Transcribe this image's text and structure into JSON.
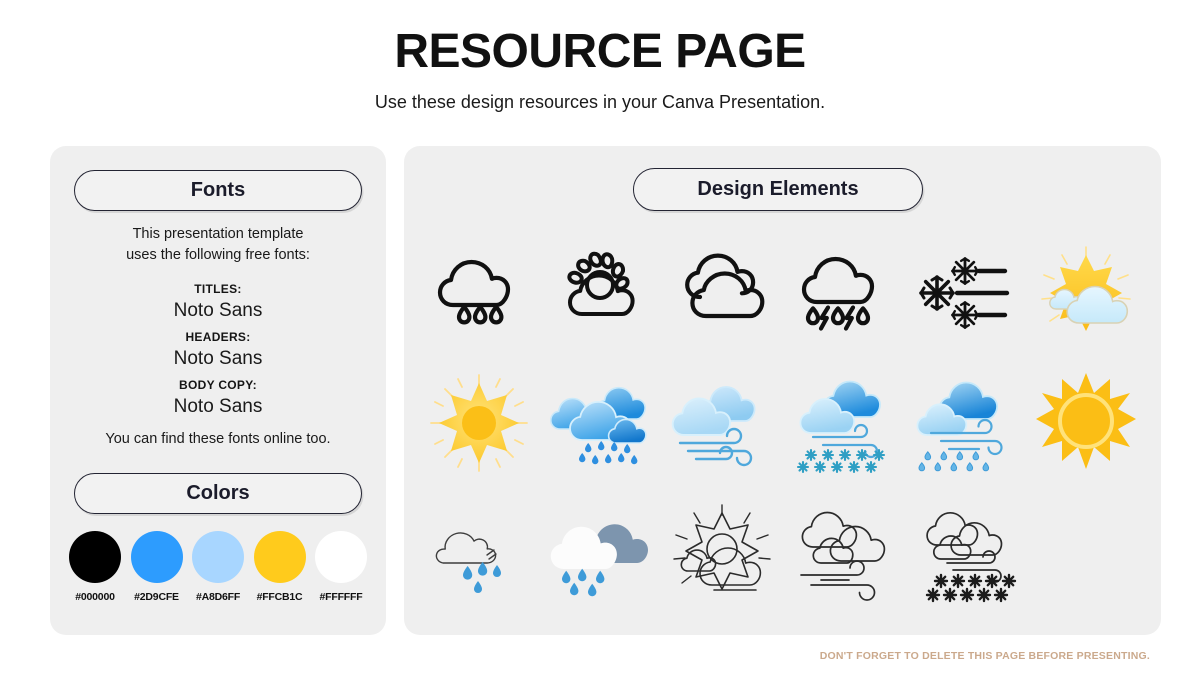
{
  "header": {
    "title": "RESOURCE PAGE",
    "subtitle": "Use these design resources in your Canva Presentation."
  },
  "fonts_panel": {
    "pill_label": "Fonts",
    "intro": "This presentation template\nuses the following free fonts:",
    "groups": [
      {
        "label": "TITLES:",
        "value": "Noto Sans"
      },
      {
        "label": "HEADERS:",
        "value": "Noto Sans"
      },
      {
        "label": "BODY COPY:",
        "value": "Noto Sans"
      }
    ],
    "outro": "You can find these fonts online too."
  },
  "colors_panel": {
    "pill_label": "Colors",
    "swatches": [
      {
        "code": "#000000",
        "hex": "#000000"
      },
      {
        "code": "#2D9CFE",
        "hex": "#2D9CFE"
      },
      {
        "code": "#A8D6FF",
        "hex": "#A8D6FF"
      },
      {
        "code": "#FFCB1C",
        "hex": "#FFCB1C"
      },
      {
        "code": "#FFFFFF",
        "hex": "#FFFFFF"
      }
    ]
  },
  "design_panel": {
    "pill_label": "Design Elements",
    "icons": [
      {
        "name": "rain-cloud-outline-icon",
        "style": "line-black"
      },
      {
        "name": "sun-behind-cloud-outline-icon",
        "style": "line-black"
      },
      {
        "name": "clouds-outline-icon",
        "style": "line-black"
      },
      {
        "name": "thunderstorm-rain-outline-icon",
        "style": "line-black"
      },
      {
        "name": "snowflakes-wind-icon",
        "style": "solid-black"
      },
      {
        "name": "sun-behind-cloud-flat-icon",
        "style": "flat-yellow"
      },
      {
        "name": "sun-flat-icon",
        "style": "flat-yellow"
      },
      {
        "name": "heavy-rain-clouds-icon",
        "style": "flat-blue"
      },
      {
        "name": "windy-clouds-icon",
        "style": "flat-blue"
      },
      {
        "name": "snow-clouds-wind-icon",
        "style": "flat-blue"
      },
      {
        "name": "rain-clouds-wind-icon",
        "style": "flat-blue"
      },
      {
        "name": "sun-bright-icon",
        "style": "flat-yellow"
      },
      {
        "name": "rain-cloud-sketch-icon",
        "style": "sketch-blue"
      },
      {
        "name": "rain-clouds-gray-icon",
        "style": "flat-gray"
      },
      {
        "name": "sun-behind-clouds-sketch-icon",
        "style": "sketch-black"
      },
      {
        "name": "windy-clouds-sketch-icon",
        "style": "sketch-black"
      },
      {
        "name": "snow-clouds-sketch-icon",
        "style": "sketch-black"
      }
    ]
  },
  "footer": {
    "note": "DON'T FORGET TO DELETE THIS PAGE BEFORE PRESENTING.",
    "color": "#cba98c"
  }
}
